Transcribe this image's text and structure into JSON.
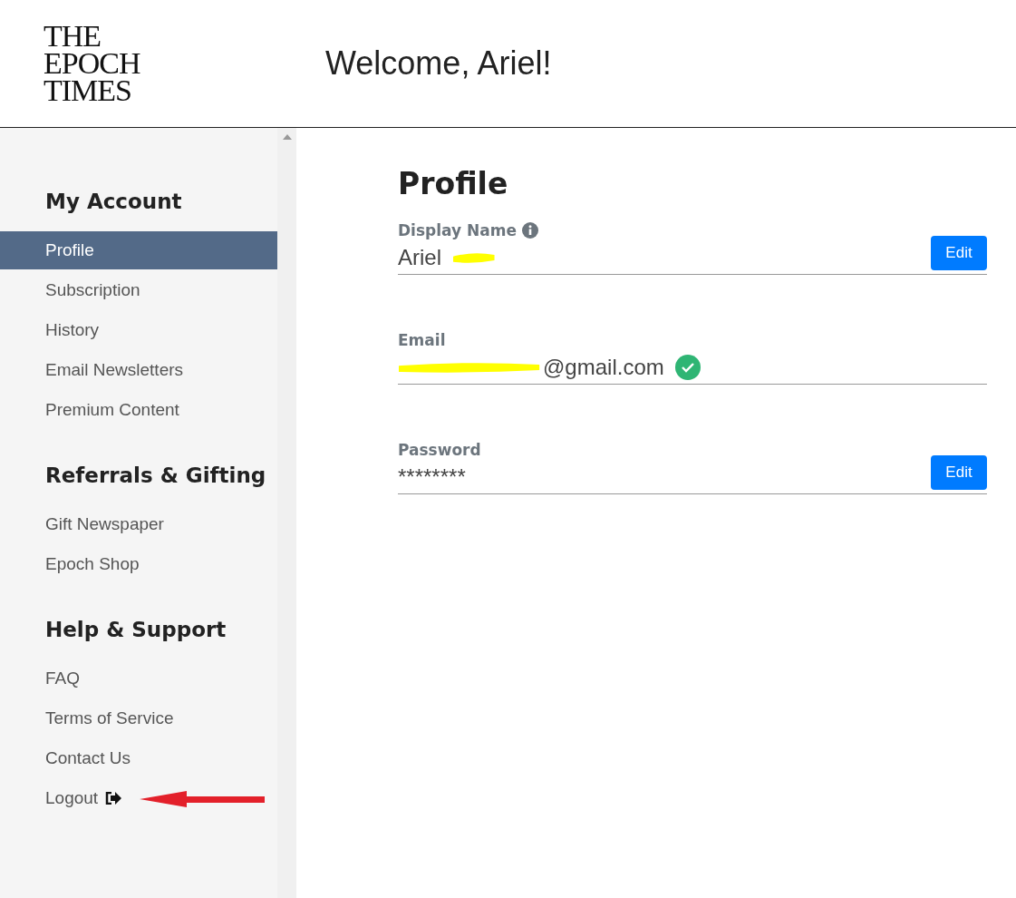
{
  "header": {
    "logo_lines": [
      "THE",
      "EPOCH",
      "TIMES"
    ],
    "welcome": "Welcome, Ariel!"
  },
  "sidebar": {
    "sections": [
      {
        "title": "My Account",
        "items": [
          {
            "label": "Profile",
            "selected": true,
            "kind": "link"
          },
          {
            "label": "Subscription",
            "selected": false,
            "kind": "link"
          },
          {
            "label": "History",
            "selected": false,
            "kind": "link"
          },
          {
            "label": "Email Newsletters",
            "selected": false,
            "kind": "link"
          },
          {
            "label": "Premium Content",
            "selected": false,
            "kind": "link"
          }
        ]
      },
      {
        "title": "Referrals & Gifting",
        "items": [
          {
            "label": "Gift Newspaper",
            "selected": false,
            "kind": "link"
          },
          {
            "label": "Epoch Shop",
            "selected": false,
            "kind": "link"
          }
        ]
      },
      {
        "title": "Help & Support",
        "items": [
          {
            "label": "FAQ",
            "selected": false,
            "kind": "link"
          },
          {
            "label": "Terms of Service",
            "selected": false,
            "kind": "link"
          },
          {
            "label": "Contact Us",
            "selected": false,
            "kind": "link"
          },
          {
            "label": "Logout",
            "selected": false,
            "kind": "logout"
          }
        ]
      }
    ]
  },
  "profile": {
    "title": "Profile",
    "fields": [
      {
        "label": "Display Name",
        "info": true,
        "value_parts": [
          {
            "kind": "text",
            "text": "Ariel"
          },
          {
            "kind": "redaction"
          }
        ],
        "verified": false,
        "button": "Edit"
      },
      {
        "label": "Email",
        "info": false,
        "value_parts": [
          {
            "kind": "redaction"
          },
          {
            "kind": "text",
            "text": "@gmail.com"
          }
        ],
        "verified": true
      },
      {
        "label": "Password",
        "info": false,
        "value_parts": [
          {
            "kind": "text",
            "text": "********"
          }
        ],
        "verified": false,
        "button": "Edit"
      }
    ]
  }
}
